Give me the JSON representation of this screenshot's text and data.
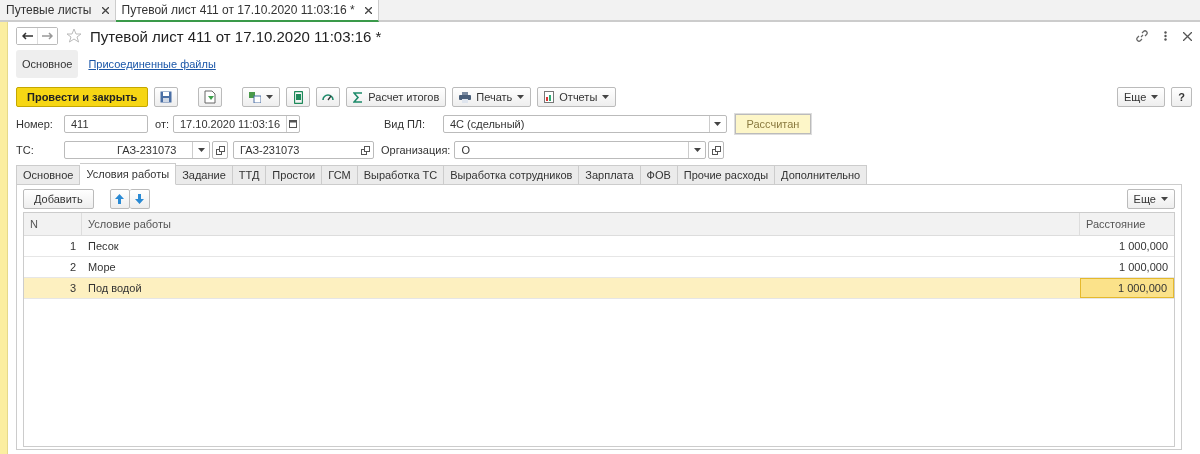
{
  "window_tabs": [
    {
      "label": "Путевые листы",
      "selected": false
    },
    {
      "label": "Путевой лист 411 от 17.10.2020 11:03:16 *",
      "selected": true
    }
  ],
  "title": "Путевой лист 411 от 17.10.2020 11:03:16 *",
  "sections": [
    {
      "label": "Основное",
      "selected": true
    },
    {
      "label": "Присоединенные файлы",
      "selected": false
    }
  ],
  "toolbar": {
    "post_button": "Провести и закрыть",
    "totals_button": "Расчет итогов",
    "print_button": "Печать",
    "reports_button": "Отчеты",
    "more_button": "Еще",
    "help_button": "?"
  },
  "fields": {
    "number": {
      "label": "Номер:",
      "value": "411"
    },
    "date": {
      "label": "от:",
      "value": "17.10.2020 11:03:16"
    },
    "kind": {
      "label": "Вид ПЛ:",
      "value": "4С (сдельный)"
    },
    "status": "Рассчитан",
    "vehicle": {
      "label": "ТС:",
      "value": "ГАЗ-231073"
    },
    "vehicle_name": {
      "value": "ГАЗ-231073"
    },
    "organization": {
      "label": "Организация:",
      "value": "О"
    }
  },
  "tabs": [
    {
      "label": "Основное",
      "selected": false
    },
    {
      "label": "Условия работы",
      "selected": true
    },
    {
      "label": "Задание",
      "selected": false
    },
    {
      "label": "ТТД",
      "selected": false
    },
    {
      "label": "Простои",
      "selected": false
    },
    {
      "label": "ГСМ",
      "selected": false
    },
    {
      "label": "Выработка ТС",
      "selected": false
    },
    {
      "label": "Выработка сотрудников",
      "selected": false
    },
    {
      "label": "Зарплата",
      "selected": false
    },
    {
      "label": "ФОВ",
      "selected": false
    },
    {
      "label": "Прочие расходы",
      "selected": false
    },
    {
      "label": "Дополнительно",
      "selected": false
    }
  ],
  "table": {
    "add_button": "Добавить",
    "more_button": "Еще",
    "columns": [
      "N",
      "Условие работы",
      "Расстояние"
    ],
    "rows": [
      {
        "n": "1",
        "condition": "Песок",
        "distance": "1 000,000",
        "selected": false
      },
      {
        "n": "2",
        "condition": "Море",
        "distance": "1 000,000",
        "selected": false
      },
      {
        "n": "3",
        "condition": "Под водой",
        "distance": "1 000,000",
        "selected": true
      }
    ]
  }
}
